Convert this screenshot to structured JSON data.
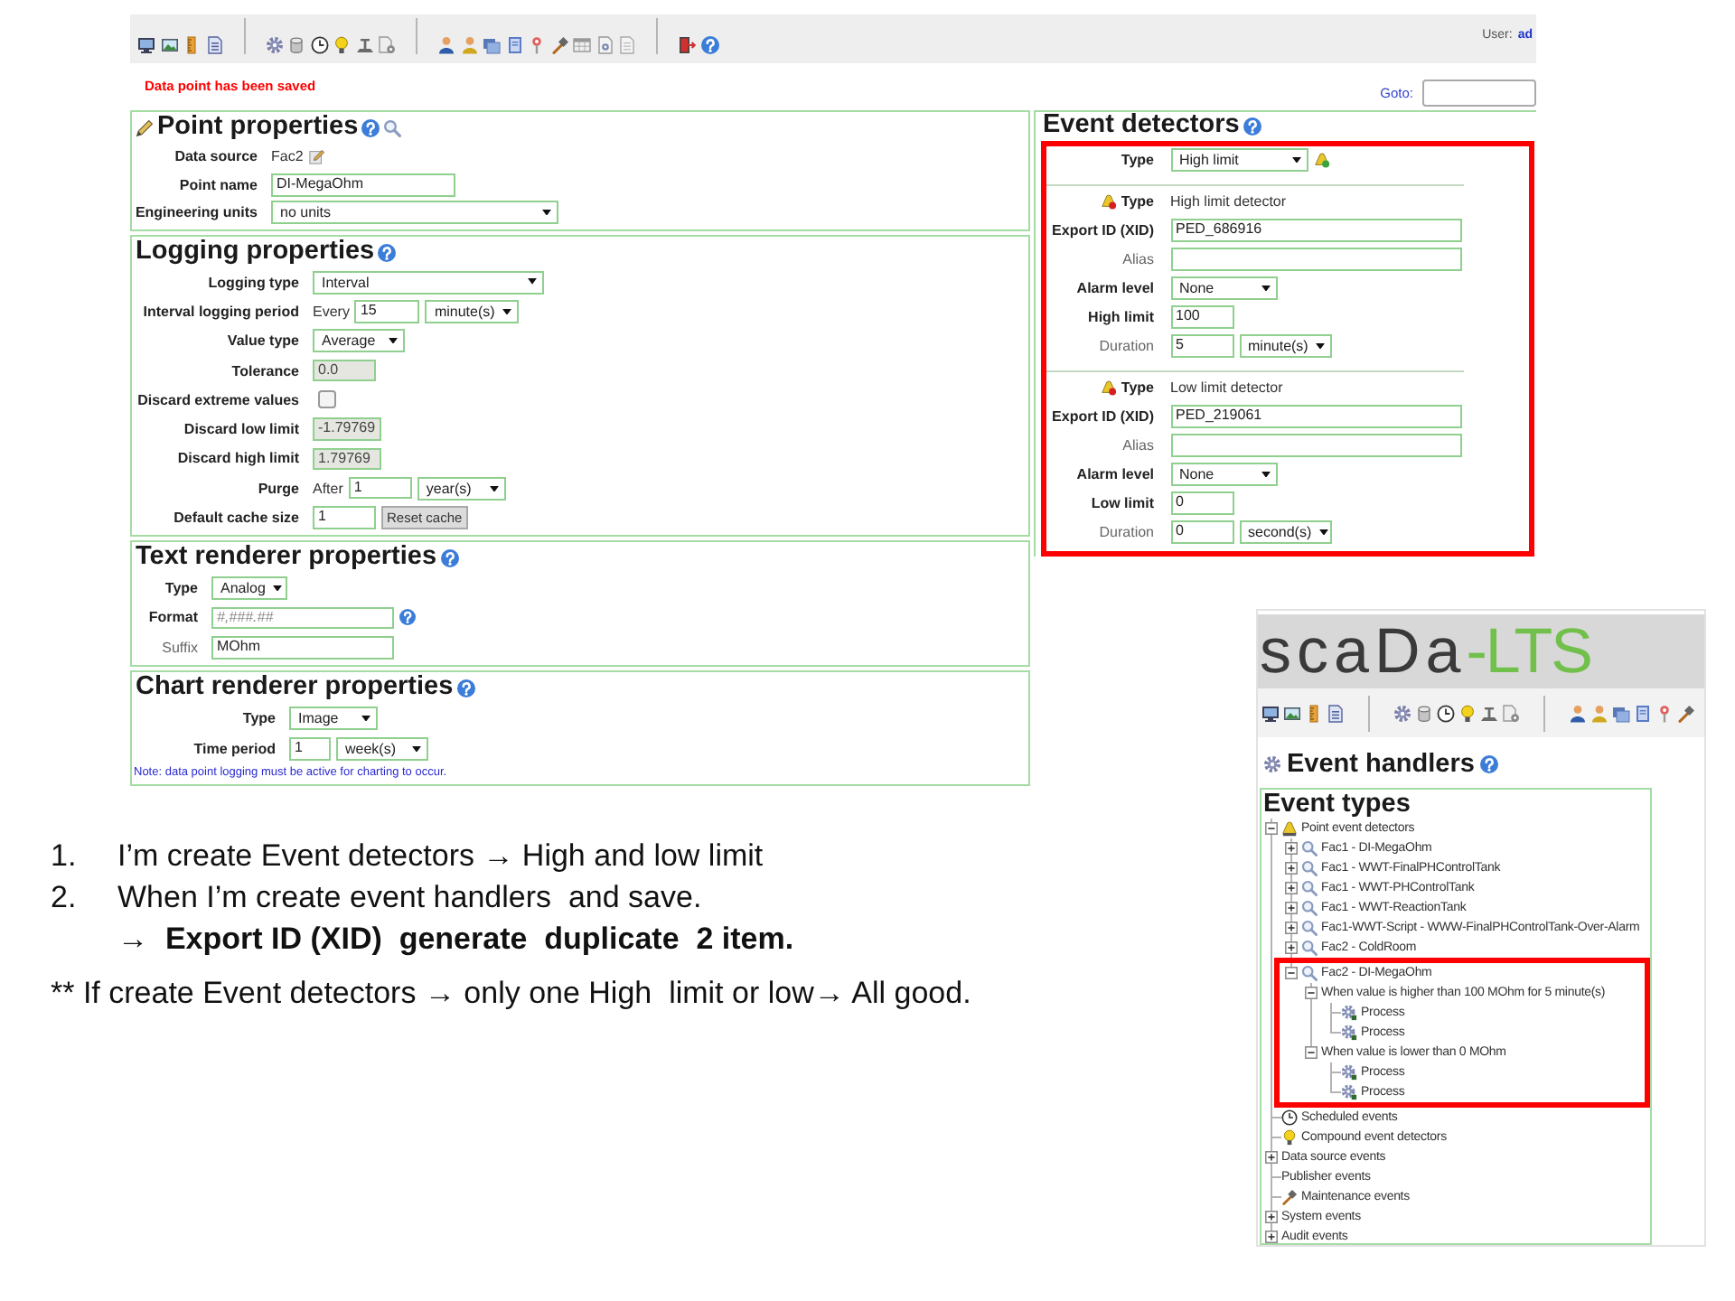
{
  "top_bar": {
    "user_label": "User:",
    "user_name": "ad"
  },
  "status_message": "Data point has been saved",
  "goto": {
    "label": "Goto:"
  },
  "sections": [
    {
      "title": "Point properties",
      "rows": [
        {
          "label": "Data source",
          "optional": false,
          "controls": [
            {
              "kind": "text",
              "value": "Fac2"
            },
            {
              "kind": "edit"
            }
          ]
        },
        {
          "label": "Point name",
          "optional": false,
          "controls": [
            {
              "kind": "input",
              "value": "DI-MegaOhm",
              "disabled": false
            }
          ]
        },
        {
          "label": "Engineering units",
          "optional": false,
          "controls": [
            {
              "kind": "select",
              "value": "no units"
            }
          ]
        }
      ]
    },
    {
      "title": "Logging properties",
      "rows": [
        {
          "label": "Logging type",
          "optional": false,
          "controls": [
            {
              "kind": "select",
              "value": "Interval"
            }
          ]
        },
        {
          "label": "Interval logging period",
          "optional": false,
          "controls": [
            {
              "kind": "text",
              "value": "Every"
            },
            {
              "kind": "input",
              "value": "15",
              "disabled": false
            },
            {
              "kind": "select",
              "value": "minute(s)"
            }
          ]
        },
        {
          "label": "Value type",
          "optional": false,
          "controls": [
            {
              "kind": "select",
              "value": "Average"
            }
          ]
        },
        {
          "label": "Tolerance",
          "optional": false,
          "controls": [
            {
              "kind": "input",
              "value": "0.0",
              "disabled": true
            }
          ]
        },
        {
          "label": "Discard extreme values",
          "optional": false,
          "controls": [
            {
              "kind": "checkbox",
              "checked": false
            }
          ]
        },
        {
          "label": "Discard low limit",
          "optional": false,
          "controls": [
            {
              "kind": "input",
              "value": "-1.79769",
              "disabled": true
            }
          ]
        },
        {
          "label": "Discard high limit",
          "optional": false,
          "controls": [
            {
              "kind": "input",
              "value": "1.79769",
              "disabled": true
            }
          ]
        },
        {
          "label": "Purge",
          "optional": false,
          "controls": [
            {
              "kind": "text",
              "value": "After"
            },
            {
              "kind": "input",
              "value": "1",
              "disabled": false
            },
            {
              "kind": "select",
              "value": "year(s)"
            }
          ]
        },
        {
          "label": "Default cache size",
          "optional": false,
          "controls": [
            {
              "kind": "input",
              "value": "1",
              "disabled": false
            },
            {
              "kind": "button",
              "label": "Reset cache"
            }
          ]
        }
      ]
    },
    {
      "title": "Text renderer properties",
      "rows": [
        {
          "label": "Type",
          "optional": false,
          "controls": [
            {
              "kind": "select",
              "value": "Analog"
            }
          ]
        },
        {
          "label": "Format",
          "optional": false,
          "controls": [
            {
              "kind": "input",
              "placeholder": "#,###.##",
              "disabled": false
            },
            {
              "kind": "help"
            }
          ]
        },
        {
          "label": "Suffix",
          "optional": true,
          "controls": [
            {
              "kind": "input",
              "value": "MOhm",
              "disabled": false
            }
          ]
        }
      ]
    },
    {
      "title": "Chart renderer properties",
      "rows": [
        {
          "label": "Type",
          "optional": false,
          "controls": [
            {
              "kind": "select",
              "value": "Image"
            }
          ]
        },
        {
          "label": "Time period",
          "optional": false,
          "controls": [
            {
              "kind": "input",
              "value": "1",
              "disabled": false
            },
            {
              "kind": "select",
              "value": "week(s)"
            }
          ]
        }
      ],
      "note": "Note: data point logging must be active for charting to occur."
    }
  ],
  "event_detectors": {
    "title": "Event detectors",
    "highlighted": true,
    "type_row": {
      "label": "Type",
      "optional": false,
      "controls": [
        {
          "kind": "select",
          "value": "High limit"
        },
        {
          "kind": "add"
        }
      ]
    },
    "detectors": [
      {
        "header": {
          "label": "Type",
          "value": "High limit detector"
        },
        "rows": [
          {
            "label": "Export ID (XID)",
            "optional": false,
            "controls": [
              {
                "kind": "input",
                "value": "PED_686916",
                "disabled": false
              }
            ]
          },
          {
            "label": "Alias",
            "optional": true,
            "controls": [
              {
                "kind": "input",
                "disabled": false
              }
            ]
          },
          {
            "label": "Alarm level",
            "optional": false,
            "controls": [
              {
                "kind": "select",
                "value": "None"
              }
            ]
          },
          {
            "label": "High limit",
            "optional": false,
            "controls": [
              {
                "kind": "input",
                "value": "100",
                "disabled": false
              }
            ]
          },
          {
            "label": "Duration",
            "optional": true,
            "controls": [
              {
                "kind": "input",
                "value": "5",
                "disabled": false
              },
              {
                "kind": "select",
                "value": "minute(s)"
              }
            ]
          }
        ]
      },
      {
        "header": {
          "label": "Type",
          "value": "Low limit detector"
        },
        "rows": [
          {
            "label": "Export ID (XID)",
            "optional": false,
            "controls": [
              {
                "kind": "input",
                "value": "PED_219061",
                "disabled": false
              }
            ]
          },
          {
            "label": "Alias",
            "optional": true,
            "controls": [
              {
                "kind": "input",
                "disabled": false
              }
            ]
          },
          {
            "label": "Alarm level",
            "optional": false,
            "controls": [
              {
                "kind": "select",
                "value": "None"
              }
            ]
          },
          {
            "label": "Low limit",
            "optional": false,
            "controls": [
              {
                "kind": "input",
                "value": "0",
                "disabled": false
              }
            ]
          },
          {
            "label": "Duration",
            "optional": true,
            "controls": [
              {
                "kind": "input",
                "value": "0",
                "disabled": false
              },
              {
                "kind": "select",
                "value": "second(s)"
              }
            ]
          }
        ]
      }
    ]
  },
  "notes": {
    "steps": [
      {
        "number": "1.",
        "text": "I’m create Event detectors → High and low limit"
      },
      {
        "number": "2.",
        "text": "When I’m create event handlers  and save.",
        "result": "→  Export ID (XID)  generate  duplicate  2 item."
      }
    ],
    "remark": "** If create Event detectors → only one High  limit or low→ All good."
  },
  "inset": {
    "logo": {
      "text": "scaDa",
      "accent": "-LTS"
    },
    "title": "Event handlers",
    "tree_title": "Event types",
    "tree": [
      {
        "kind": "detector-group",
        "label": "Point event detectors",
        "expanded": true,
        "highlighted": false,
        "children": [
          {
            "kind": "point",
            "label": "Fac1 - DI-MegaOhm",
            "expanded": false,
            "highlighted": false
          },
          {
            "kind": "point",
            "label": "Fac1 - WWT-FinalPHControlTank",
            "expanded": false,
            "highlighted": false
          },
          {
            "kind": "point",
            "label": "Fac1 - WWT-PHControlTank",
            "expanded": false,
            "highlighted": false
          },
          {
            "kind": "point",
            "label": "Fac1 - WWT-ReactionTank",
            "expanded": false,
            "highlighted": false
          },
          {
            "kind": "point",
            "label": "Fac1-WWT-Script - WWW-FinalPHControlTank-Over-Alarm",
            "expanded": false,
            "highlighted": false
          },
          {
            "kind": "point",
            "label": "Fac2 - ColdRoom",
            "expanded": false,
            "highlighted": false
          },
          {
            "kind": "point",
            "label": "Fac2 - DI-MegaOhm",
            "expanded": true,
            "highlighted": true,
            "children": [
              {
                "label": "When value is higher than 100 MOhm for 5 minute(s)",
                "expanded": true,
                "highlighted": false,
                "children": [
                  {
                    "kind": "handler",
                    "label": "Process",
                    "highlighted": false
                  },
                  {
                    "kind": "handler",
                    "label": "Process",
                    "highlighted": false
                  }
                ]
              },
              {
                "label": "When value is lower than 0 MOhm",
                "expanded": true,
                "highlighted": false,
                "children": [
                  {
                    "kind": "handler",
                    "label": "Process",
                    "highlighted": false
                  },
                  {
                    "kind": "handler",
                    "label": "Process",
                    "highlighted": false
                  }
                ]
              }
            ]
          }
        ]
      },
      {
        "kind": "scheduled",
        "label": "Scheduled events",
        "highlighted": false
      },
      {
        "kind": "compound",
        "label": "Compound event detectors",
        "highlighted": false
      },
      {
        "label": "Data source events",
        "expanded": false,
        "highlighted": false
      },
      {
        "label": "Publisher events",
        "highlighted": false
      },
      {
        "kind": "maintenance",
        "label": "Maintenance events",
        "highlighted": false
      },
      {
        "label": "System events",
        "expanded": false,
        "highlighted": false
      },
      {
        "label": "Audit events",
        "expanded": false,
        "highlighted": false
      }
    ]
  }
}
